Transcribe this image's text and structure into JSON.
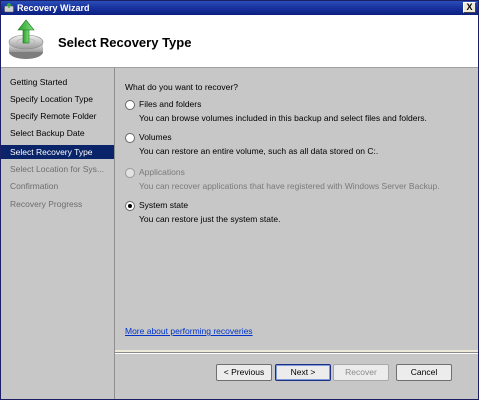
{
  "window": {
    "title": "Recovery Wizard",
    "close_glyph": "X"
  },
  "header": {
    "title": "Select Recovery Type",
    "icon": "backup-disk-green-arrow-icon"
  },
  "nav": {
    "items": [
      {
        "label": "Getting Started",
        "state": "normal"
      },
      {
        "label": "Specify Location Type",
        "state": "normal"
      },
      {
        "label": "Specify Remote Folder",
        "state": "normal"
      },
      {
        "label": "Select Backup Date",
        "state": "normal"
      },
      {
        "label": "Select Recovery Type",
        "state": "selected"
      },
      {
        "label": "Select Location for Sys...",
        "state": "disabled"
      },
      {
        "label": "Confirmation",
        "state": "disabled"
      },
      {
        "label": "Recovery Progress",
        "state": "disabled"
      }
    ]
  },
  "main": {
    "question": "What do you want to recover?",
    "options": [
      {
        "label": "Files and folders",
        "desc": "You can browse volumes included in this backup and select files and folders.",
        "checked": false,
        "enabled": true
      },
      {
        "label": "Volumes",
        "desc": "You can restore an entire volume, such as all data stored on C:.",
        "checked": false,
        "enabled": true
      },
      {
        "label": "Applications",
        "desc": "You can recover applications that have registered with Windows Server Backup.",
        "checked": false,
        "enabled": false
      },
      {
        "label": "System state",
        "desc": "You can restore just the system state.",
        "checked": true,
        "enabled": true
      }
    ],
    "more_link": "More about performing recoveries"
  },
  "buttons": {
    "previous": "< Previous",
    "next": "Next >",
    "recover": "Recover",
    "cancel": "Cancel"
  },
  "colors": {
    "selected_bg": "#0a246a",
    "pane_bg": "#c7c7c7",
    "link": "#0033cc"
  }
}
